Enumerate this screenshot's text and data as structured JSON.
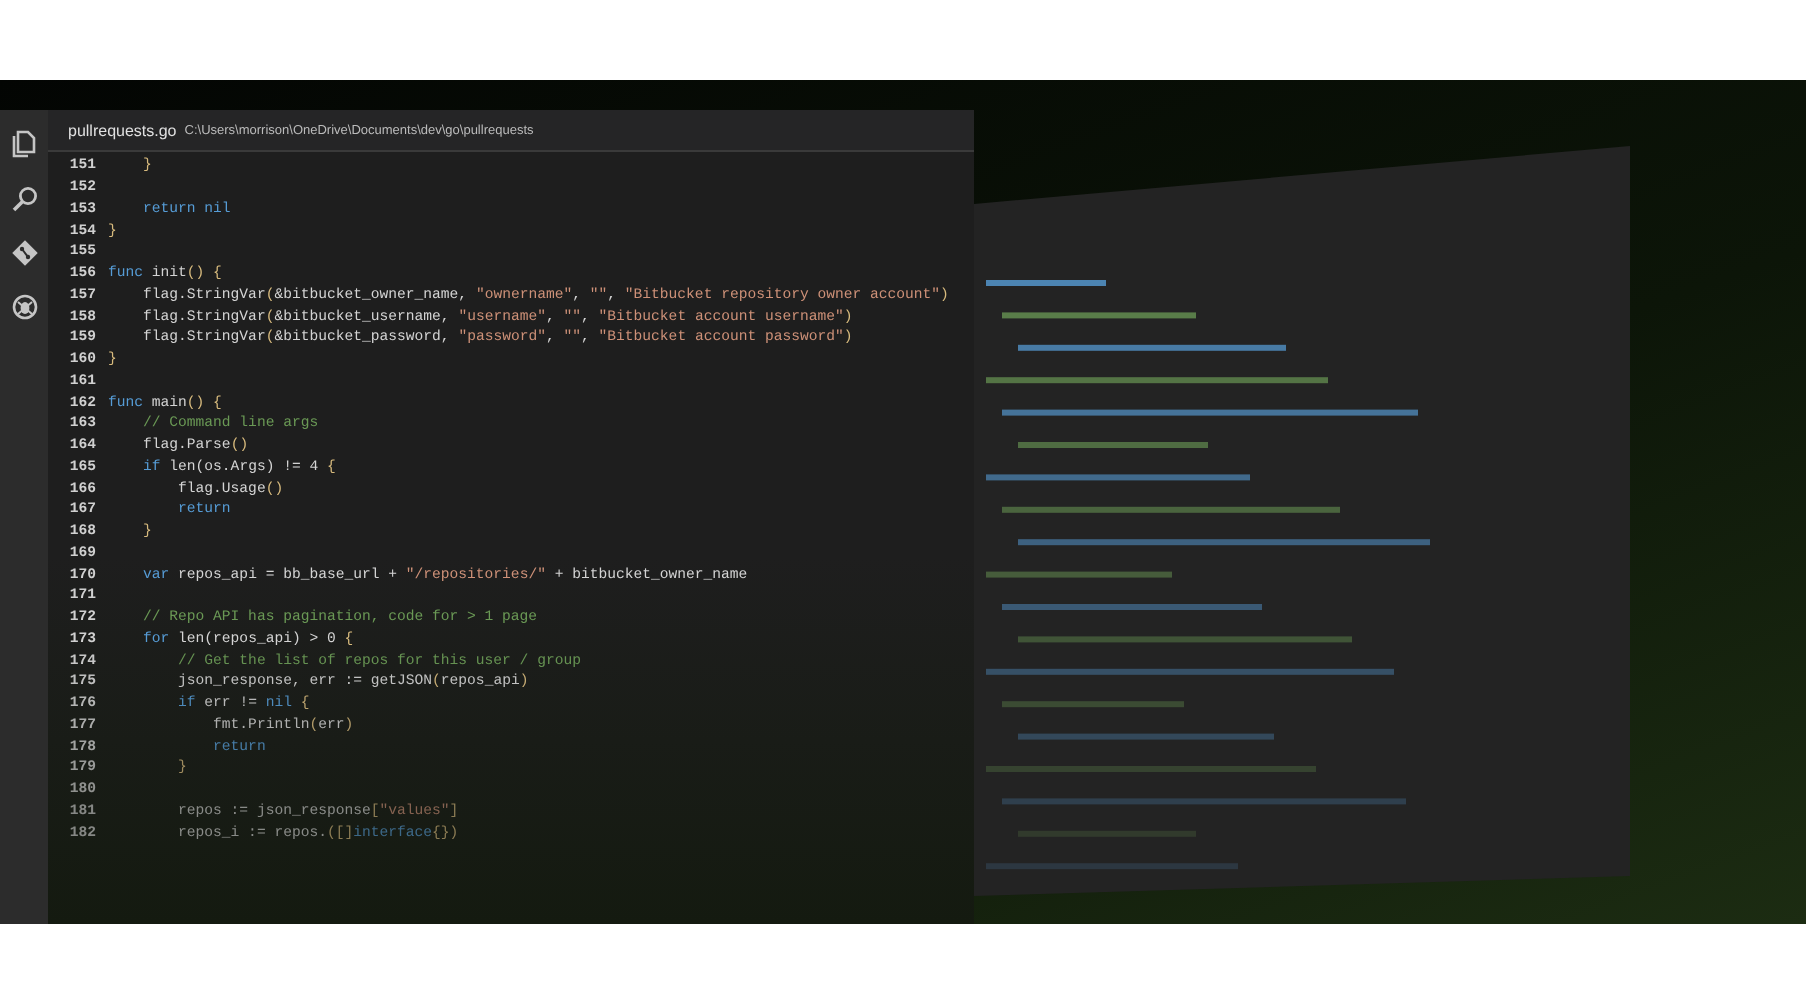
{
  "editor": {
    "file_name": "pullrequests.go",
    "file_path": "C:\\Users\\morrison\\OneDrive\\Documents\\dev\\go\\pullrequests",
    "activity_bar": [
      {
        "kind": "files"
      },
      {
        "kind": "search"
      },
      {
        "kind": "git"
      },
      {
        "kind": "debug"
      }
    ],
    "lines": [
      {
        "number": "151",
        "tokens": [
          {
            "kind": "punct",
            "text": "    }"
          }
        ]
      },
      {
        "number": "152"
      },
      {
        "number": "153",
        "tokens": [
          {
            "kind": "keyword",
            "text": "    return nil"
          }
        ]
      },
      {
        "number": "154",
        "tokens": [
          {
            "kind": "punct",
            "text": "}"
          }
        ]
      },
      {
        "number": "155"
      },
      {
        "number": "156",
        "tokens": [
          {
            "kind": "keyword",
            "text": "func"
          },
          {
            "kind": "plain",
            "text": " init"
          },
          {
            "kind": "punct",
            "text": "() {"
          }
        ]
      },
      {
        "number": "157",
        "tokens": [
          {
            "kind": "plain",
            "text": "    flag.StringVar"
          },
          {
            "kind": "punct",
            "text": "("
          },
          {
            "kind": "plain",
            "text": "&bitbucket_owner_name, "
          },
          {
            "kind": "string",
            "text": "\"ownername\""
          },
          {
            "kind": "plain",
            "text": ", "
          },
          {
            "kind": "string",
            "text": "\"\""
          },
          {
            "kind": "plain",
            "text": ", "
          },
          {
            "kind": "string",
            "text": "\"Bitbucket repository owner account\""
          },
          {
            "kind": "punct",
            "text": ")"
          }
        ]
      },
      {
        "number": "158",
        "tokens": [
          {
            "kind": "plain",
            "text": "    flag.StringVar"
          },
          {
            "kind": "punct",
            "text": "("
          },
          {
            "kind": "plain",
            "text": "&bitbucket_username, "
          },
          {
            "kind": "string",
            "text": "\"username\""
          },
          {
            "kind": "plain",
            "text": ", "
          },
          {
            "kind": "string",
            "text": "\"\""
          },
          {
            "kind": "plain",
            "text": ", "
          },
          {
            "kind": "string",
            "text": "\"Bitbucket account username\""
          },
          {
            "kind": "punct",
            "text": ")"
          }
        ]
      },
      {
        "number": "159",
        "tokens": [
          {
            "kind": "plain",
            "text": "    flag.StringVar"
          },
          {
            "kind": "punct",
            "text": "("
          },
          {
            "kind": "plain",
            "text": "&bitbucket_password, "
          },
          {
            "kind": "string",
            "text": "\"password\""
          },
          {
            "kind": "plain",
            "text": ", "
          },
          {
            "kind": "string",
            "text": "\"\""
          },
          {
            "kind": "plain",
            "text": ", "
          },
          {
            "kind": "string",
            "text": "\"Bitbucket account password\""
          },
          {
            "kind": "punct",
            "text": ")"
          }
        ]
      },
      {
        "number": "160",
        "tokens": [
          {
            "kind": "punct",
            "text": "}"
          }
        ]
      },
      {
        "number": "161"
      },
      {
        "number": "162",
        "tokens": [
          {
            "kind": "keyword",
            "text": "func"
          },
          {
            "kind": "plain",
            "text": " main"
          },
          {
            "kind": "punct",
            "text": "() {"
          }
        ]
      },
      {
        "number": "163",
        "tokens": [
          {
            "kind": "comment",
            "text": "    // Command line args"
          }
        ]
      },
      {
        "number": "164",
        "tokens": [
          {
            "kind": "plain",
            "text": "    flag.Parse"
          },
          {
            "kind": "punct",
            "text": "()"
          }
        ]
      },
      {
        "number": "165",
        "tokens": [
          {
            "kind": "keyword",
            "text": "    if"
          },
          {
            "kind": "plain",
            "text": " len(os.Args) != 4 "
          },
          {
            "kind": "punct",
            "text": "{"
          }
        ]
      },
      {
        "number": "166",
        "tokens": [
          {
            "kind": "plain",
            "text": "        flag.Usage"
          },
          {
            "kind": "punct",
            "text": "()"
          }
        ]
      },
      {
        "number": "167",
        "tokens": [
          {
            "kind": "keyword",
            "text": "        return"
          }
        ]
      },
      {
        "number": "168",
        "tokens": [
          {
            "kind": "punct",
            "text": "    }"
          }
        ]
      },
      {
        "number": "169"
      },
      {
        "number": "170",
        "tokens": [
          {
            "kind": "keyword",
            "text": "    var"
          },
          {
            "kind": "plain",
            "text": " repos_api = bb_base_url + "
          },
          {
            "kind": "string",
            "text": "\"/repositories/\""
          },
          {
            "kind": "plain",
            "text": " + bitbucket_owner_name"
          }
        ]
      },
      {
        "number": "171"
      },
      {
        "number": "172",
        "tokens": [
          {
            "kind": "comment",
            "text": "    // Repo API has pagination, code for > 1 page"
          }
        ]
      },
      {
        "number": "173",
        "tokens": [
          {
            "kind": "keyword",
            "text": "    for"
          },
          {
            "kind": "plain",
            "text": " len(repos_api) > 0 "
          },
          {
            "kind": "punct",
            "text": "{"
          }
        ]
      },
      {
        "number": "174",
        "tokens": [
          {
            "kind": "comment",
            "text": "        // Get the list of repos for this user / group"
          }
        ]
      },
      {
        "number": "175",
        "tokens": [
          {
            "kind": "plain",
            "text": "        json_response, err := getJSON"
          },
          {
            "kind": "punct",
            "text": "("
          },
          {
            "kind": "plain",
            "text": "repos_api"
          },
          {
            "kind": "punct",
            "text": ")"
          }
        ]
      },
      {
        "number": "176",
        "tokens": [
          {
            "kind": "keyword",
            "text": "        if"
          },
          {
            "kind": "plain",
            "text": " err != "
          },
          {
            "kind": "keyword",
            "text": "nil"
          },
          {
            "kind": "punct",
            "text": " {"
          }
        ]
      },
      {
        "number": "177",
        "tokens": [
          {
            "kind": "plain",
            "text": "            fmt.Println"
          },
          {
            "kind": "punct",
            "text": "("
          },
          {
            "kind": "plain",
            "text": "err"
          },
          {
            "kind": "punct",
            "text": ")"
          }
        ]
      },
      {
        "number": "178",
        "tokens": [
          {
            "kind": "keyword",
            "text": "            return"
          }
        ]
      },
      {
        "number": "179",
        "tokens": [
          {
            "kind": "punct",
            "text": "        }"
          }
        ]
      },
      {
        "number": "180"
      },
      {
        "number": "181",
        "tokens": [
          {
            "kind": "plain",
            "text": "        repos := json_response"
          },
          {
            "kind": "punct",
            "text": "["
          },
          {
            "kind": "string",
            "text": "\"values\""
          },
          {
            "kind": "punct",
            "text": "]"
          }
        ]
      },
      {
        "number": "182",
        "tokens": [
          {
            "kind": "plain",
            "text": "        repos_i := repos."
          },
          {
            "kind": "punct",
            "text": "([]"
          },
          {
            "kind": "keyword",
            "text": "interface"
          },
          {
            "kind": "punct",
            "text": "{})"
          }
        ]
      }
    ]
  }
}
